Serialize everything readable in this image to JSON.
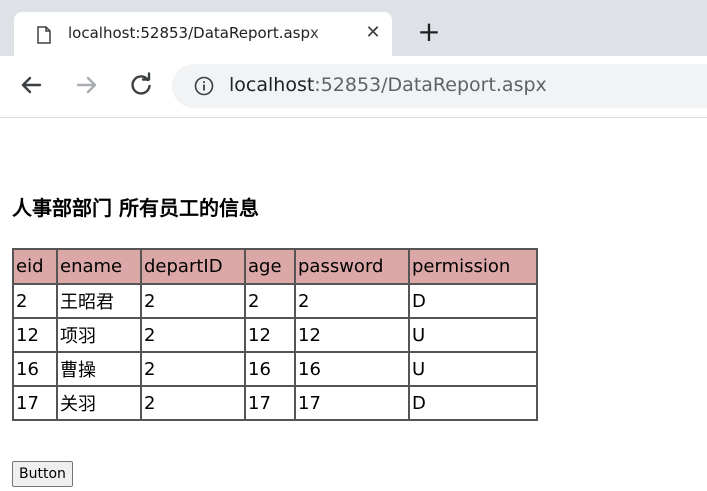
{
  "browser": {
    "tab_title": "localhost:52853/DataReport.aspx",
    "new_tab_label": "+",
    "close_label": "✕",
    "url_host": "localhost",
    "url_rest": ":52853/DataReport.aspx"
  },
  "page": {
    "heading": "人事部部门 所有员工的信息",
    "button_label": "Button",
    "table": {
      "headers": [
        "eid",
        "ename",
        "departID",
        "age",
        "password",
        "permission"
      ],
      "rows": [
        [
          "2",
          "王昭君",
          "2",
          "2",
          "2",
          "D"
        ],
        [
          "12",
          "项羽",
          "2",
          "12",
          "12",
          "U"
        ],
        [
          "16",
          "曹操",
          "2",
          "16",
          "16",
          "U"
        ],
        [
          "17",
          "关羽",
          "2",
          "17",
          "17",
          "D"
        ]
      ],
      "header_color": "#dba7a7"
    }
  }
}
